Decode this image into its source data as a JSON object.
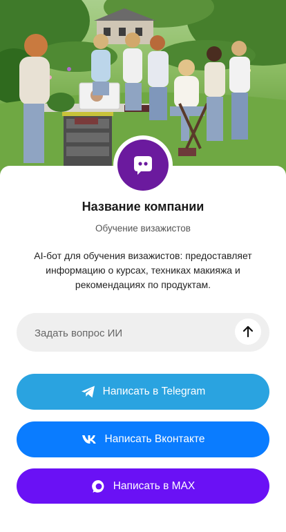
{
  "company": {
    "name": "Название компании",
    "subtitle": "Обучение визажистов",
    "description": "AI-бот для обучения визажистов: предоставляет информацию о курсах, техниках макияжа и рекомендациях по продуктам."
  },
  "ask": {
    "placeholder": "Задать вопрос ИИ",
    "value": ""
  },
  "buttons": {
    "telegram": "Написать в Telegram",
    "vk": "Написать Вконтакте",
    "max": "Написать в MAX"
  },
  "colors": {
    "avatar": "#6b1a9e",
    "telegram": "#2aa3e0",
    "vk": "#0a7cff",
    "max": "#6a11f5"
  },
  "icons": {
    "avatar": "chat-bot-icon",
    "send": "arrow-up-icon",
    "telegram": "telegram-icon",
    "vk": "vk-icon",
    "max": "max-icon"
  }
}
